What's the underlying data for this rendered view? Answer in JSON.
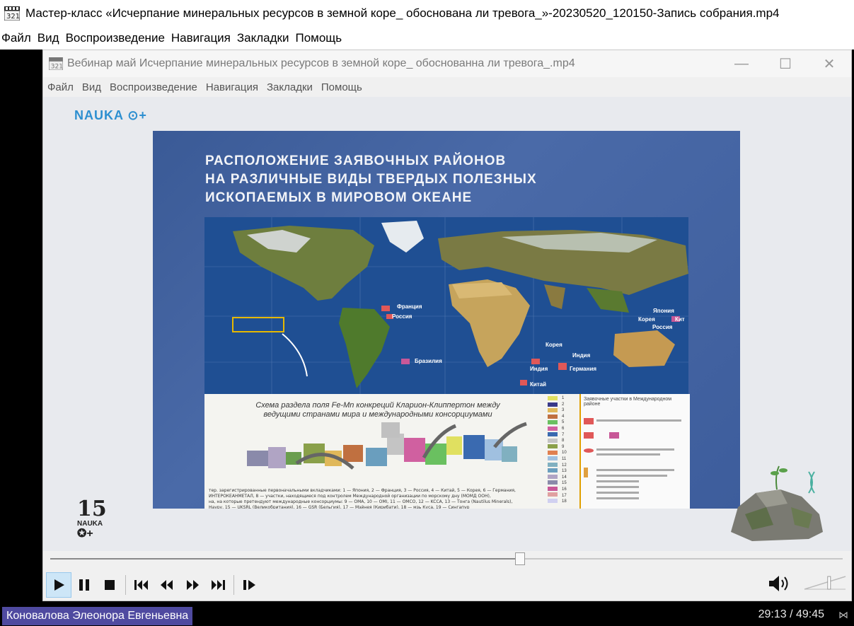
{
  "window": {
    "title": "Мастер-класс «Исчерпание минеральных ресурсов в земной коре_ обоснована ли тревога_»-20230520_120150-Запись собрания.mp4",
    "menu": [
      "Файл",
      "Вид",
      "Воспроизведение",
      "Навигация",
      "Закладки",
      "Помощь"
    ]
  },
  "inner_window": {
    "title": "Вебинар май Исчерпание минеральных ресурсов в земной коре_ обоснованна ли тревога_.mp4",
    "menu": [
      "Файл",
      "Вид",
      "Воспроизведение",
      "Навигация",
      "Закладки",
      "Помощь"
    ],
    "controls": {
      "minimize": "—",
      "maximize": "☐",
      "close": "✕"
    }
  },
  "slide": {
    "brand": "NAUKA ⊙+",
    "title_line1": "РАСПОЛОЖЕНИЕ ЗАЯВОЧНЫХ РАЙОНОВ",
    "title_line2": "НА РАЗЛИЧНЫЕ ВИДЫ ТВЕРДЫХ ПОЛЕЗНЫХ",
    "title_line3": "ИСКОПАЕМЫХ В МИРОВОМ ОКЕАНЕ",
    "map_labels": {
      "france": "Франция",
      "russia": "Россия",
      "brazil": "Бразилия",
      "korea": "Корея",
      "india": "Индия",
      "india2": "Индия",
      "germany": "Германия",
      "china": "Китай",
      "japan": "Япония",
      "korea2": "Корея",
      "kit": "Кит",
      "russia2": "Россия"
    },
    "scheme_title": "Схема раздела поля Fe-Mn конкреций Кларион-Клиппертон между ведущими странами мира и международными консорциумами",
    "legend_title": "Заявочные участки в Международном районе",
    "legend_numbers": [
      "1",
      "2",
      "3",
      "4",
      "5",
      "6",
      "7",
      "8",
      "9",
      "10",
      "11",
      "12",
      "13",
      "14",
      "15",
      "16",
      "17",
      "18"
    ],
    "anniversary": "15",
    "anniversary_brand": "NAUKA"
  },
  "player": {
    "progress": 0.593,
    "volume": 0.6,
    "current_time": "29:13",
    "total_time": "49:45"
  },
  "participant": {
    "name": "Коновалова Элеонора Евгеньевна"
  },
  "time_display": "29:13 / 49:45"
}
